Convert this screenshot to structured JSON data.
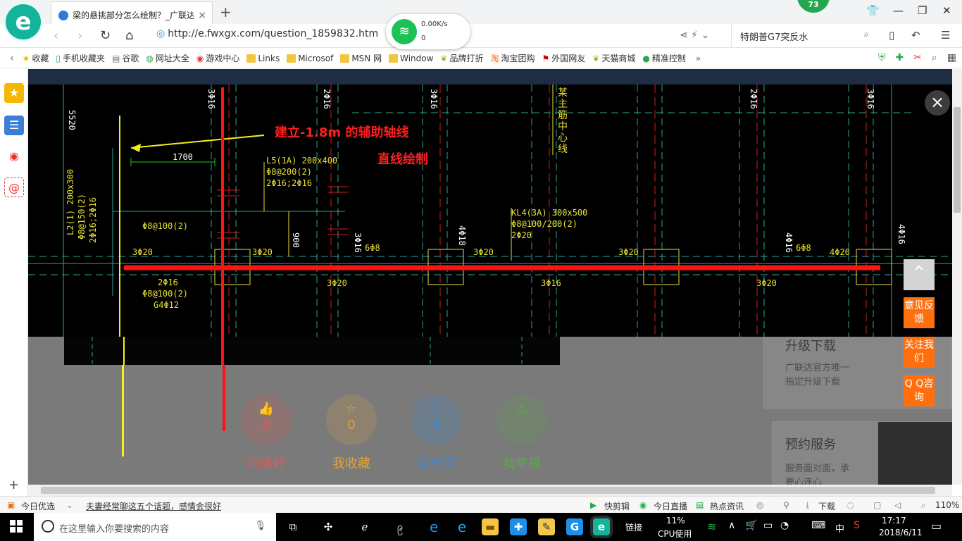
{
  "browser": {
    "logo": "e",
    "tab_title": "梁的悬挑部分怎么绘制？_广联达",
    "tab_close": "×",
    "new_tab": "+",
    "badge": "73",
    "url": "http://e.fwxgx.com/question_1859832.htm",
    "net_speed": "0.00K/s",
    "net_count": "0",
    "hot_search": "特朗普G7突反水"
  },
  "bookmarks": [
    {
      "label": "收藏",
      "icon": "star-icon"
    },
    {
      "label": "手机收藏夹",
      "icon": "phone-icon"
    },
    {
      "label": "谷歌",
      "icon": "page-icon"
    },
    {
      "label": "网址大全",
      "icon": "globe-icon"
    },
    {
      "label": "游戏中心",
      "icon": "game-icon"
    },
    {
      "label": "Links",
      "icon": "folder-icon"
    },
    {
      "label": "Microsof",
      "icon": "folder-icon"
    },
    {
      "label": "MSN 网",
      "icon": "folder-icon"
    },
    {
      "label": "Window",
      "icon": "folder-icon"
    },
    {
      "label": "品牌打折",
      "icon": "leaf-icon"
    },
    {
      "label": "淘宝团购",
      "icon": "taobao-icon"
    },
    {
      "label": "外国网友",
      "icon": "flag-icon"
    },
    {
      "label": "天猫商城",
      "icon": "leaf-icon"
    },
    {
      "label": "精准控制",
      "icon": "chat-icon"
    }
  ],
  "cad": {
    "annotation_axis": "建立-1.8m 的辅助轴线",
    "annotation_line": "直线绘制",
    "dim_1700": "1700",
    "l5_title": "L5(1A) 200x400",
    "l5_stirrup": "Φ8@200(2)",
    "l5_bars": "2Φ16;2Φ16",
    "kl4_title": "KL4(3A) 300x500",
    "kl4_stirrup": "Φ8@100/200(2)",
    "kl4_bars": "2Φ20",
    "l2_vertical": "L2(1) 200x300",
    "l2_stirrup": "Φ8@150(2)",
    "l2_bars": "2Φ16;2Φ16",
    "left_stirrup": "Φ8@100(2)",
    "bottom_bars": "2Φ16",
    "bottom_stirrup": "Φ8@100(2)",
    "bottom_g": "G4Φ12",
    "bar_3_20": "3Φ20",
    "bar_3_16": "3Φ16",
    "bar_4_20": "4Φ20",
    "bar_6_8": "6Φ8",
    "bar_2_16": "2Φ16",
    "bar_4_18": "4Φ18",
    "bar_4_16": "4Φ16",
    "dim_5520": "5520",
    "dim_900": "900",
    "dim_3_6": "3Φ16",
    "grid_note": "某主筋中心线"
  },
  "page": {
    "upgrade_title": "升级下载",
    "upgrade_line1": "广联达官方唯一",
    "upgrade_line2": "指定升级下载",
    "service_title": "预约服务",
    "service_line1": "服务面对面，承",
    "service_line2": "要心连心",
    "actions": [
      {
        "label": "问得好",
        "count": "0",
        "color": "#e05a5a",
        "icon": "thumb-up-icon"
      },
      {
        "label": "我收藏",
        "count": "0",
        "color": "#e0a23a",
        "icon": "star-icon"
      },
      {
        "label": "我分享",
        "count": "0",
        "color": "#3a8ad6",
        "icon": "share-icon"
      },
      {
        "label": "我举报",
        "count": "",
        "color": "#5aa84a",
        "icon": "warning-icon"
      }
    ],
    "close": "×",
    "to_top": "⌃",
    "feedback": "意见反馈",
    "follow": "关注我们",
    "qq": "Q Q咨询"
  },
  "status_bar": {
    "daily": "今日优选",
    "news": "夫妻经常聊这五个话题，感情会很好",
    "quick_cut": "快剪辑",
    "live": "今日直播",
    "hot_news": "热点资讯",
    "download": "下载",
    "zoom": "110%"
  },
  "taskbar": {
    "search_placeholder": "在这里输入你要搜索的内容",
    "link": "链接",
    "cpu_pct": "11%",
    "cpu_label": "CPU使用",
    "ime": "中",
    "time": "17:17",
    "date": "2018/6/11"
  }
}
